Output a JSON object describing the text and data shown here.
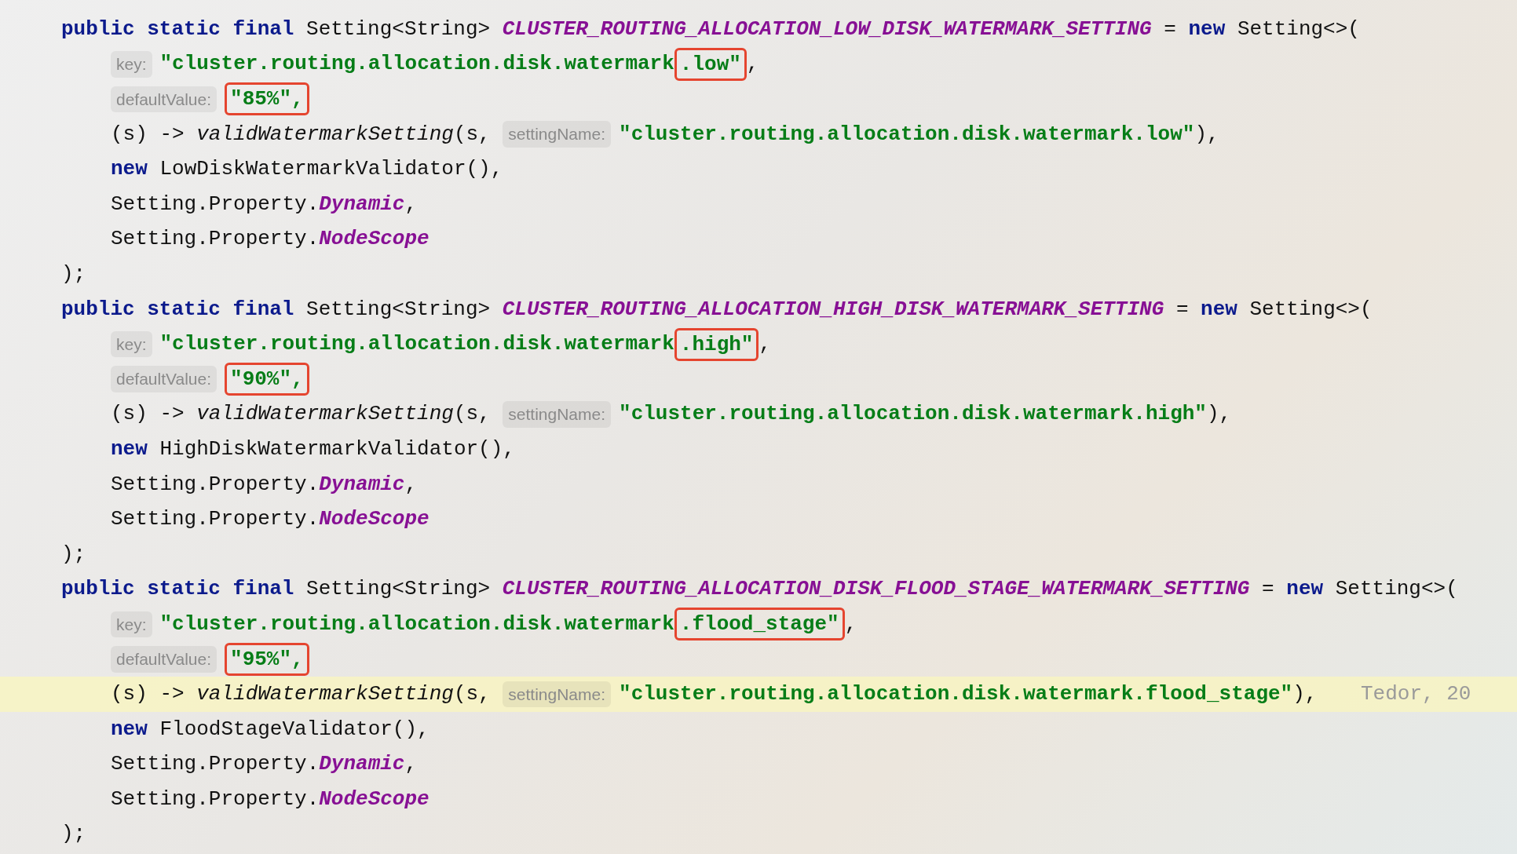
{
  "declarations": [
    {
      "header": [
        {
          "kind": "kw",
          "text": "public static final",
          "boxed": false
        },
        {
          "kind": "plain",
          "text": "Setting<String>",
          "boxed": false
        },
        {
          "kind": "const",
          "text": "CLUSTER_ROUTING_ALLOCATION_LOW_DISK_WATERMARK_SETTING",
          "boxed": false
        },
        {
          "kind": "plain",
          "text": "=",
          "boxed": false
        },
        {
          "kind": "kw",
          "text": "new",
          "boxed": false
        },
        {
          "kind": "plain",
          "text": "Setting<>(",
          "boxed": false
        }
      ],
      "children": [
        {
          "current": false,
          "tokens": [
            {
              "kind": "hint",
              "text": "key:",
              "boxed": false
            },
            {
              "kind": "str",
              "text": "\"cluster.routing.allocation.disk.watermark",
              "boxed": false
            },
            {
              "kind": "str",
              "text": ".low\"",
              "boxed": true
            },
            {
              "kind": "plain",
              "text": ",",
              "boxed": false
            }
          ]
        },
        {
          "current": false,
          "tokens": [
            {
              "kind": "hint",
              "text": "defaultValue:",
              "boxed": false
            },
            {
              "kind": "str",
              "text": "\"85%\",",
              "boxed": true
            }
          ]
        },
        {
          "current": false,
          "tokens": [
            {
              "kind": "plain",
              "text": "(s) ->",
              "boxed": false
            },
            {
              "kind": "call",
              "text": "validWatermarkSetting",
              "boxed": false
            },
            {
              "kind": "plain",
              "text": "(s,",
              "boxed": false
            },
            {
              "kind": "hint",
              "text": "settingName:",
              "boxed": false
            },
            {
              "kind": "str",
              "text": "\"cluster.routing.allocation.disk.watermark.low\"",
              "boxed": false
            },
            {
              "kind": "plain",
              "text": "),",
              "boxed": false
            }
          ]
        },
        {
          "current": false,
          "tokens": [
            {
              "kind": "kw",
              "text": "new",
              "boxed": false
            },
            {
              "kind": "plain",
              "text": "LowDiskWatermarkValidator(),",
              "boxed": false
            }
          ]
        },
        {
          "current": false,
          "tokens": [
            {
              "kind": "plain",
              "text": "Setting.Property.",
              "boxed": false
            },
            {
              "kind": "field",
              "text": "Dynamic",
              "boxed": false
            },
            {
              "kind": "plain",
              "text": ",",
              "boxed": false
            }
          ]
        },
        {
          "current": false,
          "tokens": [
            {
              "kind": "plain",
              "text": "Setting.Property.",
              "boxed": false
            },
            {
              "kind": "field",
              "text": "NodeScope",
              "boxed": false
            }
          ]
        }
      ],
      "footer": ");"
    },
    {
      "header": [
        {
          "kind": "kw",
          "text": "public static final",
          "boxed": false
        },
        {
          "kind": "plain",
          "text": "Setting<String>",
          "boxed": false
        },
        {
          "kind": "const",
          "text": "CLUSTER_ROUTING_ALLOCATION_HIGH_DISK_WATERMARK_SETTING",
          "boxed": false
        },
        {
          "kind": "plain",
          "text": "=",
          "boxed": false
        },
        {
          "kind": "kw",
          "text": "new",
          "boxed": false
        },
        {
          "kind": "plain",
          "text": "Setting<>(",
          "boxed": false
        }
      ],
      "children": [
        {
          "current": false,
          "tokens": [
            {
              "kind": "hint",
              "text": "key:",
              "boxed": false
            },
            {
              "kind": "str",
              "text": "\"cluster.routing.allocation.disk.watermark",
              "boxed": false
            },
            {
              "kind": "str",
              "text": ".high\"",
              "boxed": true
            },
            {
              "kind": "plain",
              "text": ",",
              "boxed": false
            }
          ]
        },
        {
          "current": false,
          "tokens": [
            {
              "kind": "hint",
              "text": "defaultValue:",
              "boxed": false
            },
            {
              "kind": "str",
              "text": "\"90%\",",
              "boxed": true
            }
          ]
        },
        {
          "current": false,
          "tokens": [
            {
              "kind": "plain",
              "text": "(s) ->",
              "boxed": false
            },
            {
              "kind": "call",
              "text": "validWatermarkSetting",
              "boxed": false
            },
            {
              "kind": "plain",
              "text": "(s,",
              "boxed": false
            },
            {
              "kind": "hint",
              "text": "settingName:",
              "boxed": false
            },
            {
              "kind": "str",
              "text": "\"cluster.routing.allocation.disk.watermark.high\"",
              "boxed": false
            },
            {
              "kind": "plain",
              "text": "),",
              "boxed": false
            }
          ]
        },
        {
          "current": false,
          "tokens": [
            {
              "kind": "kw",
              "text": "new",
              "boxed": false
            },
            {
              "kind": "plain",
              "text": "HighDiskWatermarkValidator(),",
              "boxed": false
            }
          ]
        },
        {
          "current": false,
          "tokens": [
            {
              "kind": "plain",
              "text": "Setting.Property.",
              "boxed": false
            },
            {
              "kind": "field",
              "text": "Dynamic",
              "boxed": false
            },
            {
              "kind": "plain",
              "text": ",",
              "boxed": false
            }
          ]
        },
        {
          "current": false,
          "tokens": [
            {
              "kind": "plain",
              "text": "Setting.Property.",
              "boxed": false
            },
            {
              "kind": "field",
              "text": "NodeScope",
              "boxed": false
            }
          ]
        }
      ],
      "footer": ");"
    },
    {
      "header": [
        {
          "kind": "kw",
          "text": "public static final",
          "boxed": false
        },
        {
          "kind": "plain",
          "text": "Setting<String>",
          "boxed": false
        },
        {
          "kind": "const",
          "text": "CLUSTER_ROUTING_ALLOCATION_DISK_FLOOD_STAGE_WATERMARK_SETTING",
          "boxed": false
        },
        {
          "kind": "plain",
          "text": "=",
          "boxed": false
        },
        {
          "kind": "kw",
          "text": "new",
          "boxed": false
        },
        {
          "kind": "plain",
          "text": "Setting<>(",
          "boxed": false
        }
      ],
      "children": [
        {
          "current": false,
          "tokens": [
            {
              "kind": "hint",
              "text": "key:",
              "boxed": false
            },
            {
              "kind": "str",
              "text": "\"cluster.routing.allocation.disk.watermark",
              "boxed": false
            },
            {
              "kind": "str",
              "text": ".flood_stage\"",
              "boxed": true
            },
            {
              "kind": "plain",
              "text": ",",
              "boxed": false
            }
          ]
        },
        {
          "current": false,
          "tokens": [
            {
              "kind": "hint",
              "text": "defaultValue:",
              "boxed": false
            },
            {
              "kind": "str",
              "text": "\"95%\",",
              "boxed": true
            }
          ]
        },
        {
          "current": true,
          "tokens": [
            {
              "kind": "plain",
              "text": "(s) ->",
              "boxed": false
            },
            {
              "kind": "call",
              "text": "validWatermarkSetting",
              "boxed": false
            },
            {
              "kind": "plain",
              "text": "(s,",
              "boxed": false
            },
            {
              "kind": "hint",
              "text": "settingName:",
              "boxed": false
            },
            {
              "kind": "str",
              "text": "\"cluster.routing.allocation.disk.watermark.flood_stage\"",
              "boxed": false
            },
            {
              "kind": "plain",
              "text": "),",
              "boxed": false
            },
            {
              "kind": "blame",
              "text": "Tedor, 20",
              "boxed": false
            }
          ]
        },
        {
          "current": false,
          "tokens": [
            {
              "kind": "kw",
              "text": "new",
              "boxed": false
            },
            {
              "kind": "plain",
              "text": "FloodStageValidator(),",
              "boxed": false
            }
          ]
        },
        {
          "current": false,
          "tokens": [
            {
              "kind": "plain",
              "text": "Setting.Property.",
              "boxed": false
            },
            {
              "kind": "field",
              "text": "Dynamic",
              "boxed": false
            },
            {
              "kind": "plain",
              "text": ",",
              "boxed": false
            }
          ]
        },
        {
          "current": false,
          "tokens": [
            {
              "kind": "plain",
              "text": "Setting.Property.",
              "boxed": false
            },
            {
              "kind": "field",
              "text": "NodeScope",
              "boxed": false
            }
          ]
        }
      ],
      "footer": ");"
    }
  ]
}
